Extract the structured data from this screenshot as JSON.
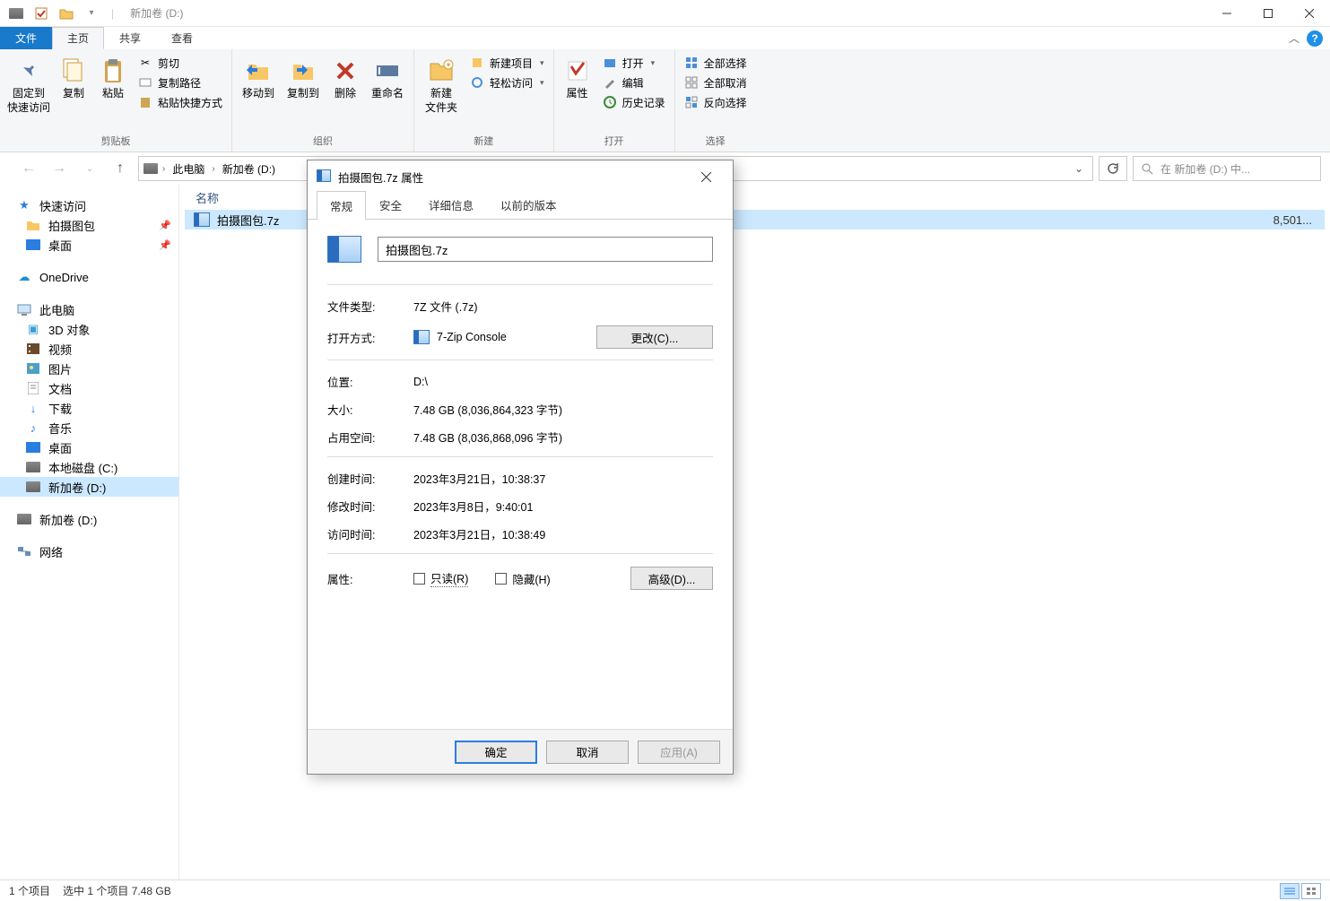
{
  "window": {
    "title": "新加卷 (D:)"
  },
  "tabs": {
    "file": "文件",
    "home": "主页",
    "share": "共享",
    "view": "查看"
  },
  "ribbon": {
    "clipboard": {
      "label": "剪贴板",
      "pin": "固定到\n快速访问",
      "copy": "复制",
      "paste": "粘贴",
      "cut": "剪切",
      "copy_path": "复制路径",
      "paste_shortcut": "粘贴快捷方式"
    },
    "organize": {
      "label": "组织",
      "move_to": "移动到",
      "copy_to": "复制到",
      "delete": "删除",
      "rename": "重命名"
    },
    "new": {
      "label": "新建",
      "new_folder": "新建\n文件夹",
      "new_item": "新建项目",
      "easy_access": "轻松访问"
    },
    "open": {
      "label": "打开",
      "properties": "属性",
      "open": "打开",
      "edit": "编辑",
      "history": "历史记录"
    },
    "select": {
      "label": "选择",
      "select_all": "全部选择",
      "select_none": "全部取消",
      "invert": "反向选择"
    }
  },
  "addressbar": {
    "this_pc": "此电脑",
    "drive": "新加卷 (D:)"
  },
  "search": {
    "placeholder": "在 新加卷 (D:) 中..."
  },
  "sidebar": {
    "quick_access": "快速访问",
    "items_qa": [
      {
        "label": "拍摄图包",
        "pin": true
      },
      {
        "label": "桌面",
        "pin": true
      }
    ],
    "onedrive": "OneDrive",
    "this_pc": "此电脑",
    "items_pc": [
      "3D 对象",
      "视频",
      "图片",
      "文档",
      "下载",
      "音乐",
      "桌面",
      "本地磁盘 (C:)",
      "新加卷 (D:)"
    ],
    "d_drive_second": "新加卷 (D:)",
    "network": "网络"
  },
  "content": {
    "column_name": "名称",
    "row": {
      "name": "拍摄图包.7z",
      "size_trunc": "8,501..."
    }
  },
  "statusbar": {
    "items": "1 个项目",
    "selected": "选中 1 个项目 7.48 GB"
  },
  "dialog": {
    "title": "拍摄图包.7z 属性",
    "tabs": {
      "general": "常规",
      "security": "安全",
      "details": "详细信息",
      "previous": "以前的版本"
    },
    "filename": "拍摄图包.7z",
    "rows": {
      "type_label": "文件类型:",
      "type_value": "7Z 文件 (.7z)",
      "open_with_label": "打开方式:",
      "open_with_value": "7-Zip Console",
      "change_btn": "更改(C)...",
      "location_label": "位置:",
      "location_value": "D:\\",
      "size_label": "大小:",
      "size_value": "7.48 GB (8,036,864,323 字节)",
      "size_on_disk_label": "占用空间:",
      "size_on_disk_value": "7.48 GB (8,036,868,096 字节)",
      "created_label": "创建时间:",
      "created_value": "2023年3月21日，10:38:37",
      "modified_label": "修改时间:",
      "modified_value": "2023年3月8日，9:40:01",
      "accessed_label": "访问时间:",
      "accessed_value": "2023年3月21日，10:38:49",
      "attrs_label": "属性:",
      "readonly": "只读(R)",
      "hidden": "隐藏(H)",
      "advanced": "高级(D)..."
    },
    "footer": {
      "ok": "确定",
      "cancel": "取消",
      "apply": "应用(A)"
    }
  }
}
